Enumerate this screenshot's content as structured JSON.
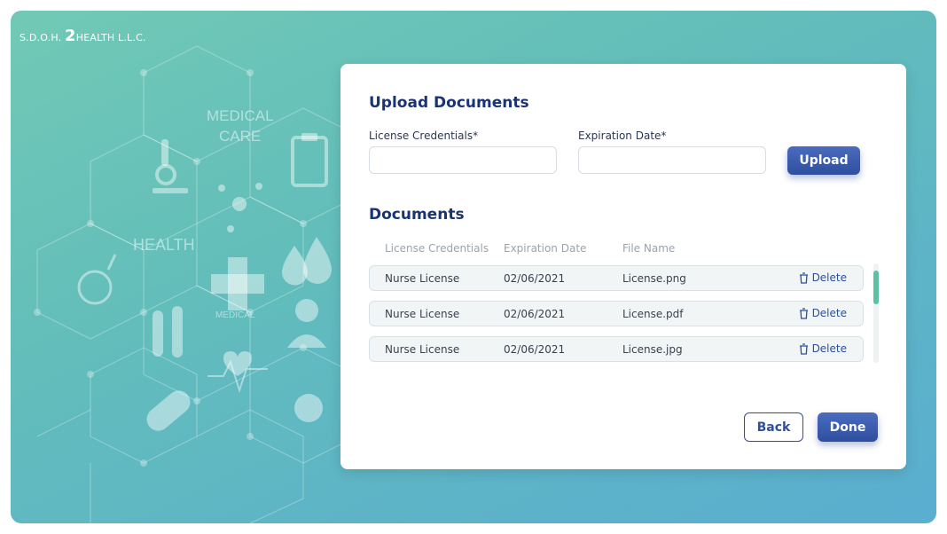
{
  "brand": {
    "prefix": "S.D.O.H.",
    "number": "2",
    "suffix": "HEALTH L.L.C."
  },
  "background_labels": {
    "medical_care": [
      "MEDICAL",
      "CARE"
    ],
    "health": "HEALTH",
    "medical": "MEDICAL"
  },
  "upload": {
    "title": "Upload Documents",
    "license_label": "License Credentials*",
    "license_value": "",
    "expiration_label": "Expiration Date*",
    "expiration_value": "",
    "upload_button": "Upload"
  },
  "documents": {
    "title": "Documents",
    "columns": [
      "License Credentials",
      "Expiration Date",
      "File Name"
    ],
    "rows": [
      {
        "credential": "Nurse License",
        "expiration": "02/06/2021",
        "file": "License.png",
        "action": "Delete"
      },
      {
        "credential": "Nurse License",
        "expiration": "02/06/2021",
        "file": "License.pdf",
        "action": "Delete"
      },
      {
        "credential": "Nurse License",
        "expiration": "02/06/2021",
        "file": "License.jpg",
        "action": "Delete"
      }
    ],
    "action_icon": "trash-icon"
  },
  "footer": {
    "back": "Back",
    "done": "Done"
  },
  "colors": {
    "primary": "#2f4e9e",
    "heading": "#1a3473",
    "scroll_accent": "#5cc0a4",
    "bg_start": "#71c9b5",
    "bg_end": "#5aaed0"
  }
}
